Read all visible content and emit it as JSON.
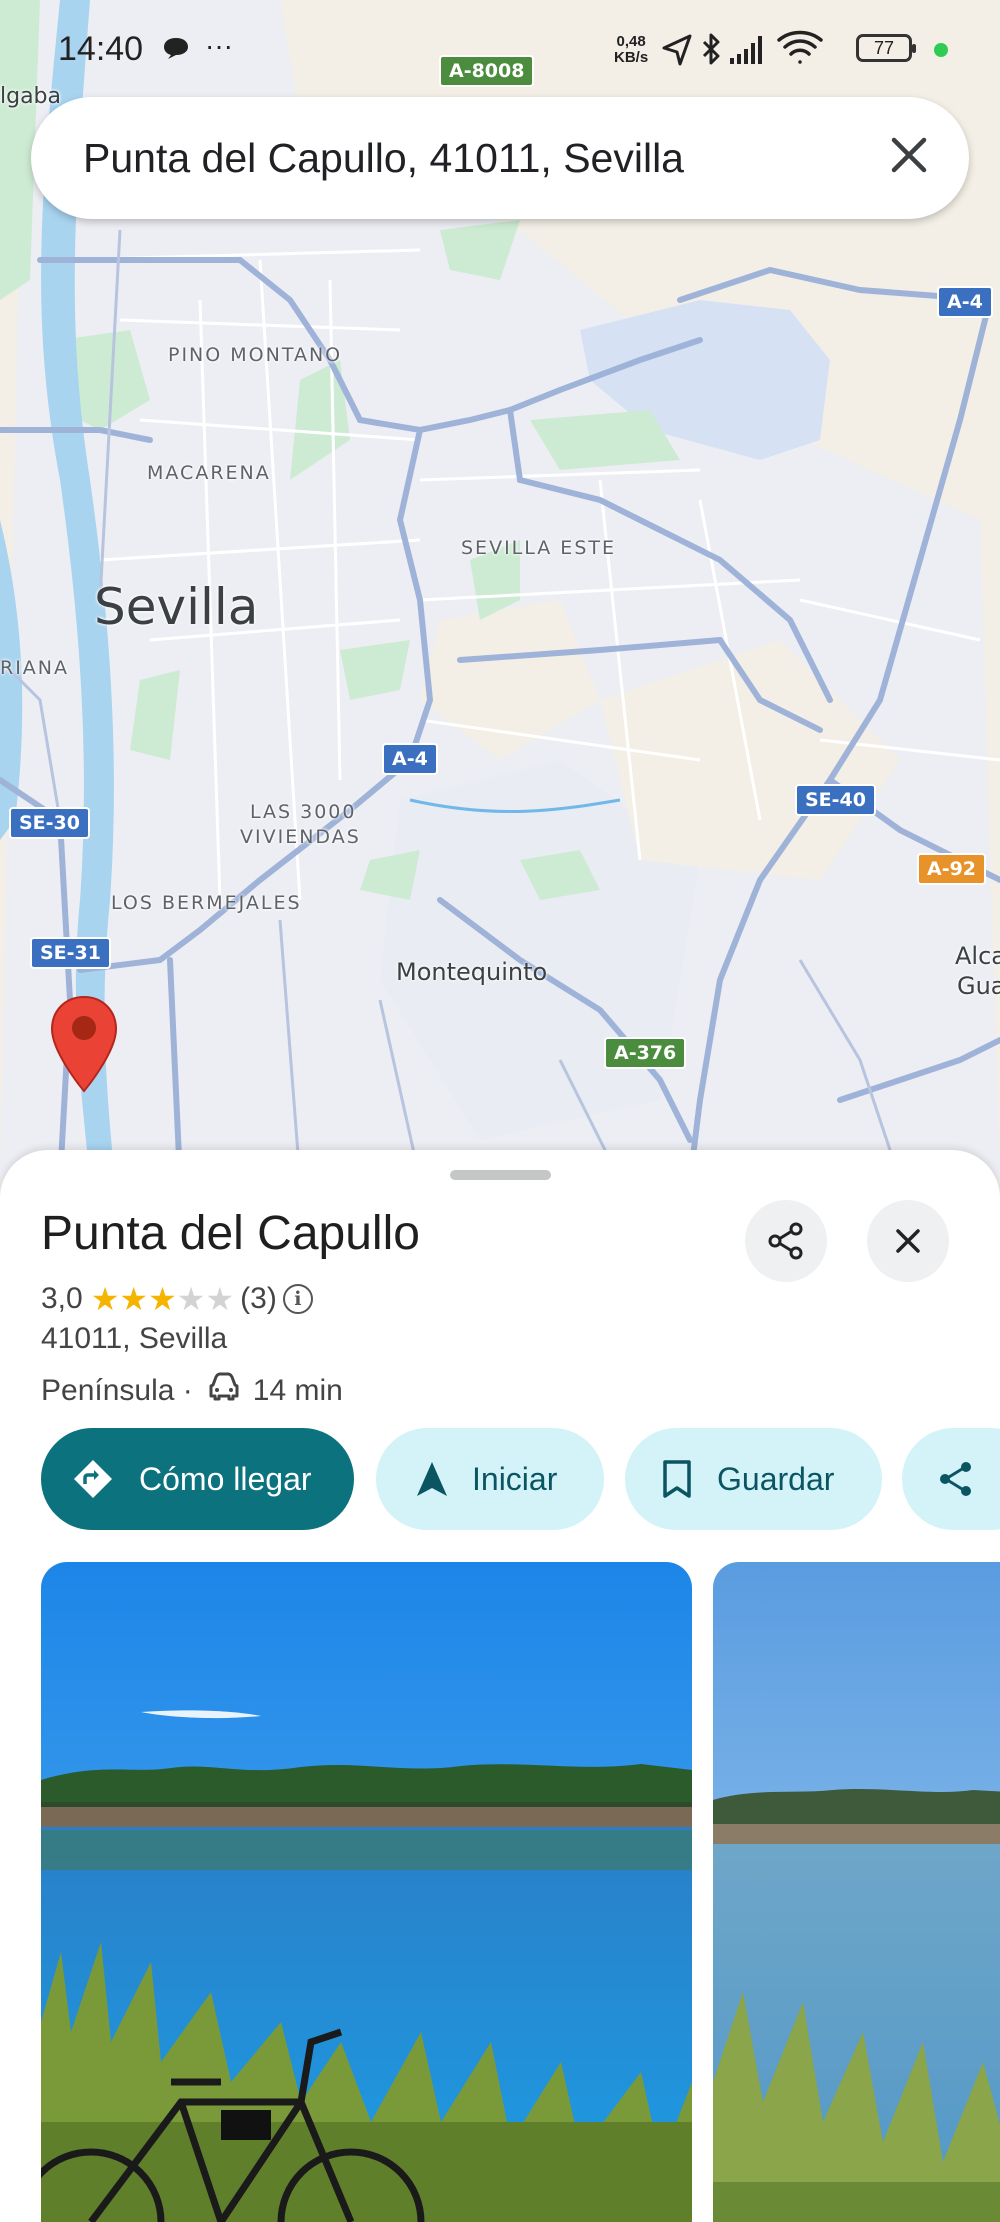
{
  "status_bar": {
    "time": "14:40",
    "dots": "···",
    "net_speed_value": "0,48",
    "net_speed_unit": "KB/s",
    "battery": "77",
    "icons": [
      "chat-bubble-icon",
      "location-arrow-icon",
      "bluetooth-icon",
      "signal-icon",
      "wifi-icon",
      "battery-icon"
    ]
  },
  "search": {
    "query": "Punta del Capullo, 41011, Sevilla"
  },
  "map": {
    "labels": {
      "algaba": "lgaba",
      "pino_montano": "PINO MONTANO",
      "macarena": "MACARENA",
      "sevilla_este": "SEVILLA ESTE",
      "sevilla": "Sevilla",
      "triana": "RIANA",
      "las3000_line1": "LAS 3000",
      "las3000_line2": "VIVIENDAS",
      "bermejales": "LOS BERMEJALES",
      "montequinto": "Montequinto",
      "alcala_line1": "Alca",
      "alcala_line2": "Gua"
    },
    "shields": {
      "a8008": "A-8008",
      "a4_top": "A-4",
      "a4_mid": "A-4",
      "se30": "SE-30",
      "se40": "SE-40",
      "a92": "A-92",
      "se31": "SE-31",
      "a376": "A-376"
    },
    "colors": {
      "land": "#f3efe6",
      "urban": "#eceef3",
      "park": "#cdebd3",
      "water": "#a8d4f0",
      "road": "#9fb3d9",
      "pin": "#ea4335"
    }
  },
  "place": {
    "title": "Punta del Capullo",
    "rating": "3,0",
    "stars_value": 3,
    "stars_max": 5,
    "review_count": "(3)",
    "info_glyph": "i",
    "address": "41011, Sevilla",
    "area": "Península ·",
    "drive_time": "14 min"
  },
  "actions": {
    "directions": "Cómo llegar",
    "start": "Iniciar",
    "save": "Guardar"
  },
  "photos": {
    "colors": {
      "sky": "#2b8fe6",
      "water": "#1a7fd6",
      "reeds": "#7a9a3a"
    }
  }
}
